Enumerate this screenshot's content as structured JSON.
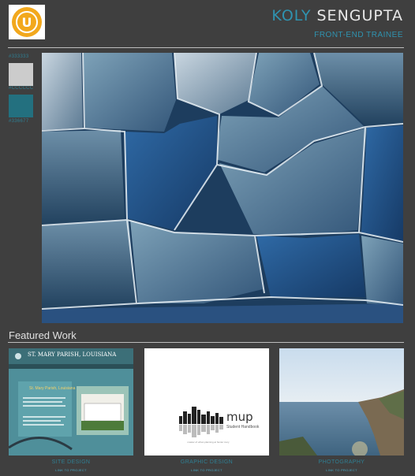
{
  "header": {
    "name_first": "KOLY",
    "name_last": "SENGUPTA",
    "role": "FRONT-END TRAINEE",
    "logo_letter": "U"
  },
  "swatches": [
    {
      "label": "#333333",
      "color": "#333333"
    },
    {
      "label": "#CCCCCC",
      "color": "#cccccc"
    },
    {
      "label": "#336677",
      "color": "#23707f"
    }
  ],
  "featured": {
    "title": "Featured Work",
    "items": [
      {
        "label": "SITE DESIGN",
        "link": "LINK TO PROJECT"
      },
      {
        "label": "GRAPHIC DESIGN",
        "link": "LINK TO PROJECT"
      },
      {
        "label": "PHOTOGRAPHY",
        "link": "LINK TO PROJECT"
      }
    ],
    "site_design": {
      "banner": "ST. MARY PARISH, LOUISIANA",
      "heading": "St. Mary Parish, Louisiana"
    },
    "graphic_design": {
      "brand": "mup",
      "subtitle": "Student Handbook",
      "caption": "master of urban planning at hunter cuny"
    }
  }
}
